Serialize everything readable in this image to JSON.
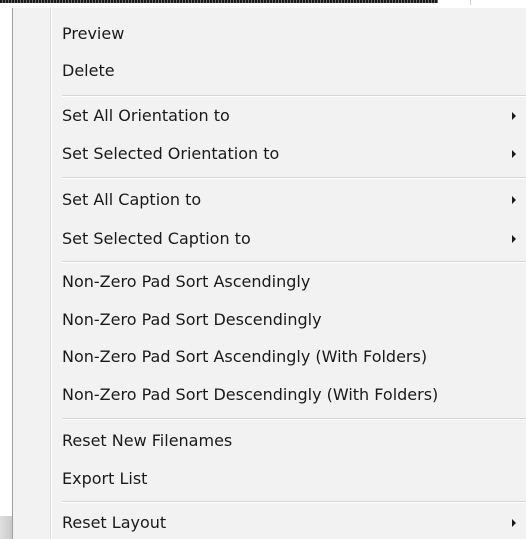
{
  "menu": {
    "items": [
      {
        "label": "Preview",
        "submenu": false
      },
      {
        "label": "Delete",
        "submenu": false
      },
      {
        "label": "Set All Orientation to",
        "submenu": true
      },
      {
        "label": "Set Selected Orientation to",
        "submenu": true
      },
      {
        "label": "Set All Caption to",
        "submenu": true
      },
      {
        "label": "Set Selected Caption to",
        "submenu": true
      },
      {
        "label": "Non-Zero Pad Sort Ascendingly",
        "submenu": false
      },
      {
        "label": "Non-Zero Pad Sort Descendingly",
        "submenu": false
      },
      {
        "label": "Non-Zero Pad Sort Ascendingly (With Folders)",
        "submenu": false
      },
      {
        "label": "Non-Zero Pad Sort Descendingly (With Folders)",
        "submenu": false
      },
      {
        "label": "Reset New Filenames",
        "submenu": false
      },
      {
        "label": "Export List",
        "submenu": false
      },
      {
        "label": "Reset Layout",
        "submenu": true
      }
    ],
    "submenu_icon": "chevron-right-icon"
  },
  "colors": {
    "menu_background": "#f2f2f2",
    "text": "#1a1a1a",
    "separator": "#d7d7d7"
  }
}
